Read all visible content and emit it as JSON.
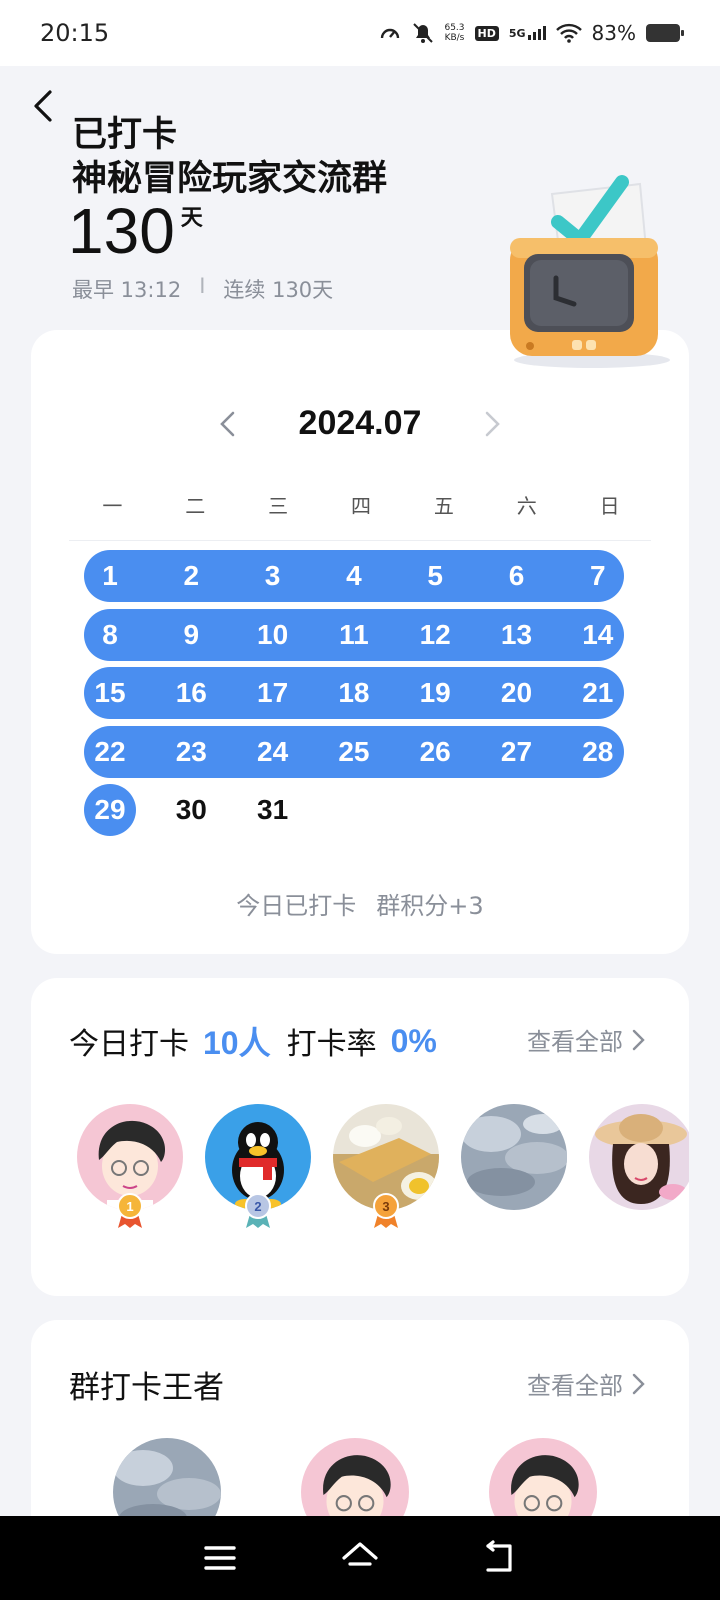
{
  "status_bar": {
    "time": "20:15",
    "net_speed_value": "65.3",
    "net_speed_unit": "KB/s",
    "hd": "HD",
    "network": "5G",
    "battery": "83%"
  },
  "header": {
    "status": "已打卡",
    "group_name": "神秘冒险玩家交流群",
    "days": "130",
    "days_unit": "天",
    "earliest": "最早 13:12",
    "separator": "I",
    "streak": "连续 130天"
  },
  "calendar": {
    "month": "2024.07",
    "weekdays": [
      "一",
      "二",
      "三",
      "四",
      "五",
      "六",
      "日"
    ],
    "weeks": [
      [
        "1",
        "2",
        "3",
        "4",
        "5",
        "6",
        "7"
      ],
      [
        "8",
        "9",
        "10",
        "11",
        "12",
        "13",
        "14"
      ],
      [
        "15",
        "16",
        "17",
        "18",
        "19",
        "20",
        "21"
      ],
      [
        "22",
        "23",
        "24",
        "25",
        "26",
        "27",
        "28"
      ],
      [
        "29",
        "30",
        "31"
      ]
    ],
    "checked_days": [
      1,
      2,
      3,
      4,
      5,
      6,
      7,
      8,
      9,
      10,
      11,
      12,
      13,
      14,
      15,
      16,
      17,
      18,
      19,
      20,
      21,
      22,
      23,
      24,
      25,
      26,
      27,
      28,
      29
    ],
    "footer_status": "今日已打卡",
    "footer_points": "群积分+3",
    "accent_color": "#4a8ef0"
  },
  "today": {
    "label": "今日打卡",
    "count": "10人",
    "rate_label": "打卡率",
    "rate": "0%",
    "view_all": "查看全部",
    "ranks": [
      "1",
      "2",
      "3"
    ]
  },
  "king": {
    "title": "群打卡王者",
    "view_all": "查看全部"
  }
}
